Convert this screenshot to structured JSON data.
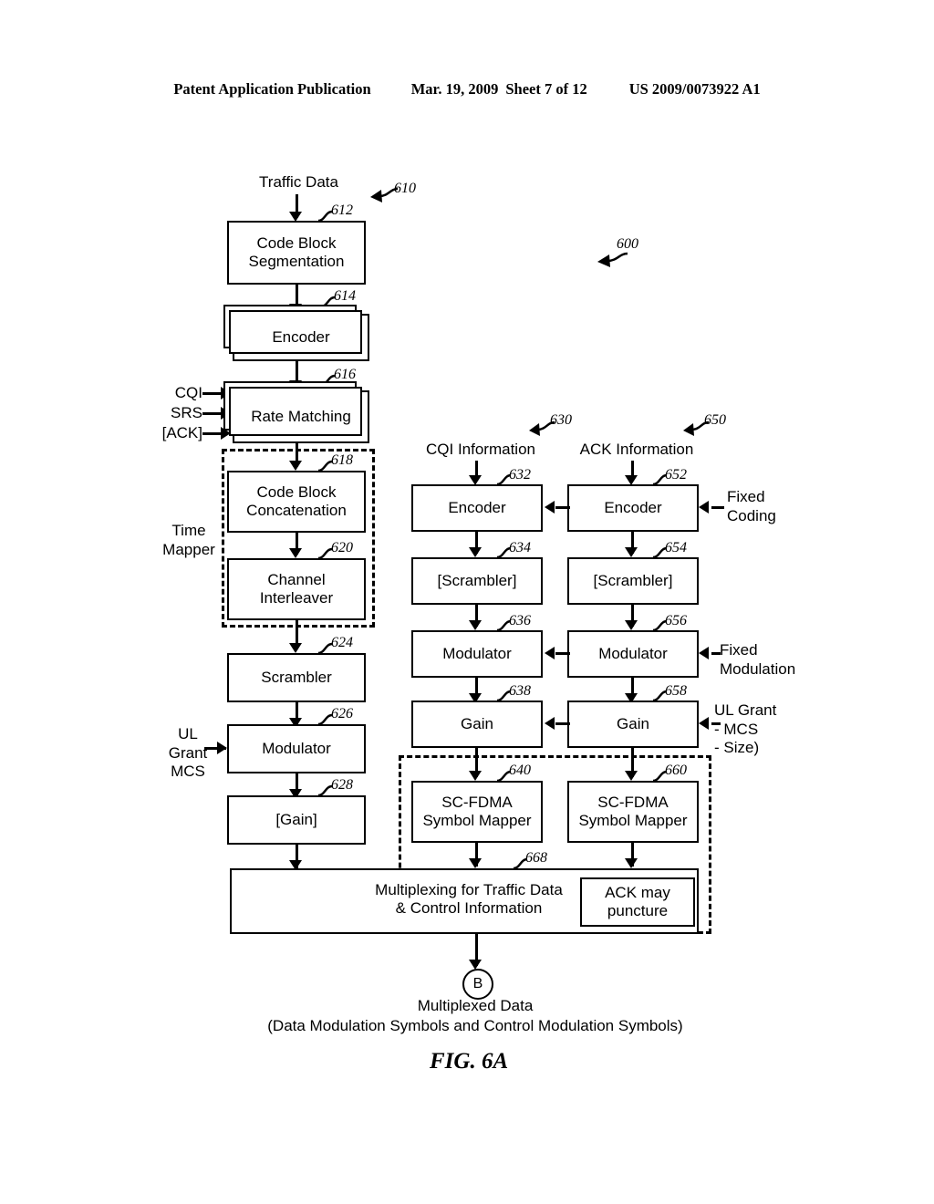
{
  "header": {
    "publication": "Patent Application Publication",
    "date": "Mar. 19, 2009",
    "sheet": "Sheet 7 of 12",
    "patent_number": "US 2009/0073922 A1"
  },
  "figure": {
    "label": "FIG. 6A",
    "overall_ref": "600"
  },
  "traffic_chain": {
    "ref": "610",
    "input_label": "Traffic Data",
    "side_inputs": [
      "CQI",
      "SRS",
      "[ACK]"
    ],
    "ul_grant_label": "UL\nGrant\nMCS",
    "time_mapper_label": "Time\nMapper",
    "blocks": [
      {
        "ref": "612",
        "label": "Code Block\nSegmentation"
      },
      {
        "ref": "614",
        "label": "Encoder"
      },
      {
        "ref": "616",
        "label": "Rate Matching"
      },
      {
        "ref": "618",
        "label": "Code Block\nConcatenation"
      },
      {
        "ref": "620",
        "label": "Channel\nInterleaver"
      },
      {
        "ref": "624",
        "label": "Scrambler"
      },
      {
        "ref": "626",
        "label": "Modulator"
      },
      {
        "ref": "628",
        "label": "[Gain]"
      }
    ]
  },
  "cqi_chain": {
    "ref": "630",
    "input_label": "CQI Information",
    "blocks": [
      {
        "ref": "632",
        "label": "Encoder"
      },
      {
        "ref": "634",
        "label": "[Scrambler]"
      },
      {
        "ref": "636",
        "label": "Modulator"
      },
      {
        "ref": "638",
        "label": "Gain"
      },
      {
        "ref": "640",
        "label": "SC-FDMA\nSymbol Mapper"
      }
    ]
  },
  "ack_chain": {
    "ref": "650",
    "input_label": "ACK Information",
    "blocks": [
      {
        "ref": "652",
        "label": "Encoder"
      },
      {
        "ref": "654",
        "label": "[Scrambler]"
      },
      {
        "ref": "656",
        "label": "Modulator"
      },
      {
        "ref": "658",
        "label": "Gain"
      },
      {
        "ref": "660",
        "label": "SC-FDMA\nSymbol Mapper"
      }
    ],
    "right_annotations": [
      {
        "name": "fixed-coding",
        "text": "Fixed\nCoding"
      },
      {
        "name": "fixed-modulation",
        "text": "Fixed\nModulation"
      },
      {
        "name": "ul-grant",
        "text": "UL Grant\n- MCS\n- Size)"
      }
    ]
  },
  "multiplexing": {
    "ref": "668",
    "label": "Multiplexing for Traffic Data\n& Control Information",
    "inner_note": "ACK may\npuncture"
  },
  "output": {
    "connector": "B",
    "line1": "Multiplexed Data",
    "line2": "(Data Modulation Symbols and Control Modulation Symbols)"
  }
}
